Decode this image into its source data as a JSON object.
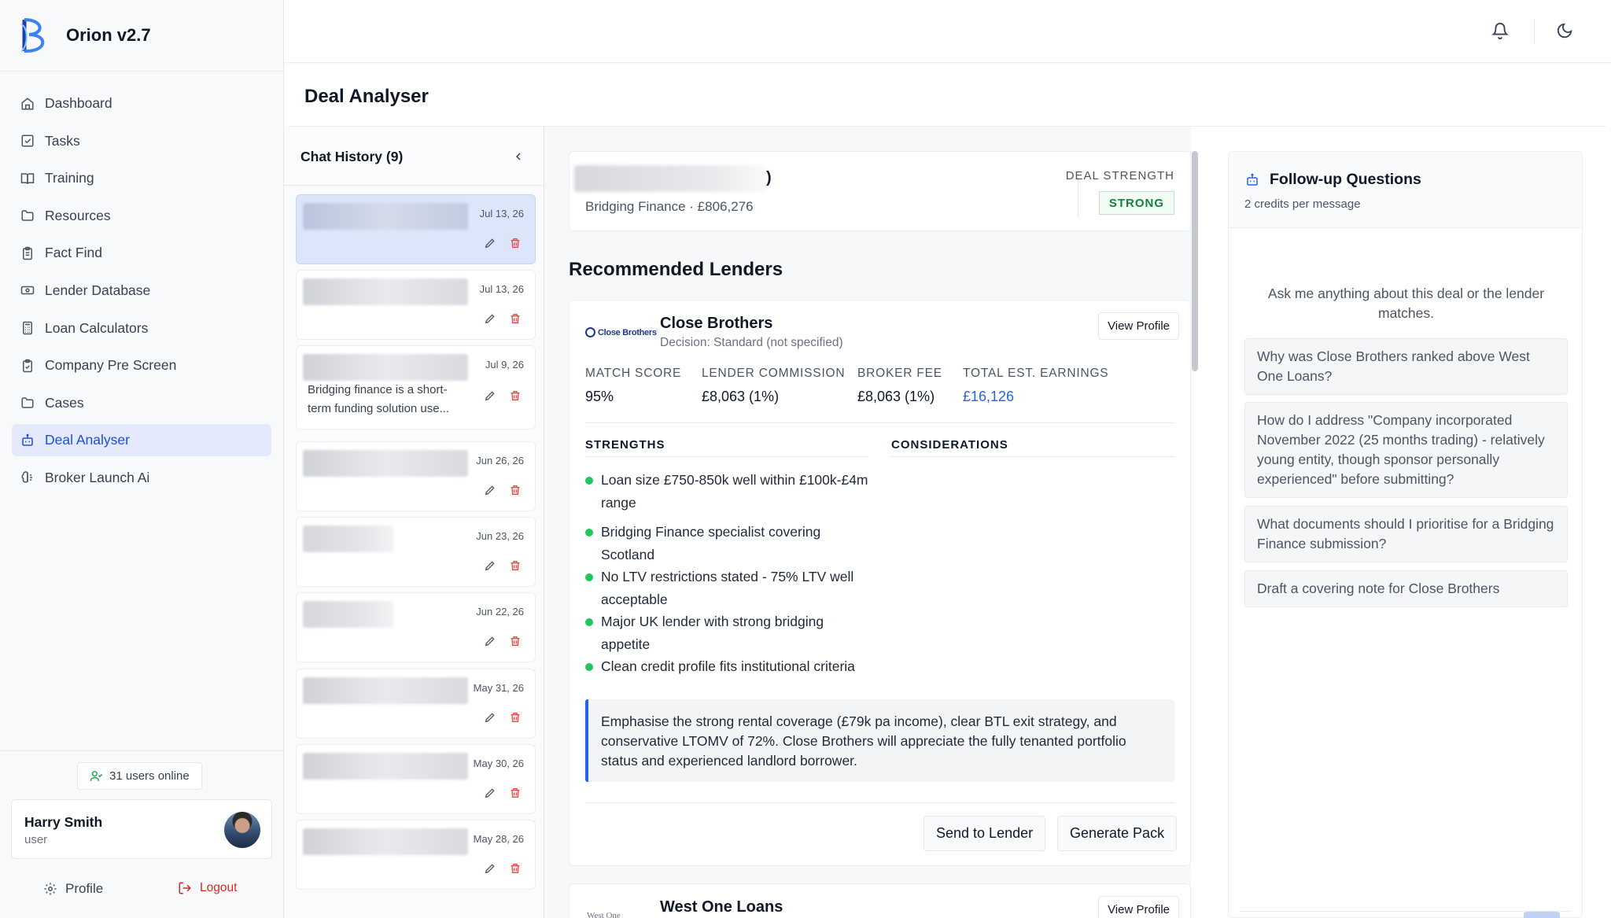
{
  "app": {
    "name": "Orion v2.7"
  },
  "sidebar": {
    "items": [
      {
        "label": "Dashboard",
        "icon": "home-icon"
      },
      {
        "label": "Tasks",
        "icon": "checkbox-icon"
      },
      {
        "label": "Training",
        "icon": "book-icon"
      },
      {
        "label": "Resources",
        "icon": "folder-icon"
      },
      {
        "label": "Fact Find",
        "icon": "clipboard-icon"
      },
      {
        "label": "Lender Database",
        "icon": "banknote-icon"
      },
      {
        "label": "Loan Calculators",
        "icon": "calculator-icon"
      },
      {
        "label": "Company Pre Screen",
        "icon": "clipboard-check-icon"
      },
      {
        "label": "Cases",
        "icon": "folder-icon"
      },
      {
        "label": "Deal Analyser",
        "icon": "bot-icon",
        "active": true
      },
      {
        "label": "Broker Launch Ai",
        "icon": "brain-icon"
      }
    ],
    "online": "31 users online",
    "user": {
      "name": "Harry Smith",
      "role": "user"
    },
    "profile_label": "Profile",
    "logout_label": "Logout"
  },
  "page": {
    "title": "Deal Analyser"
  },
  "history": {
    "title": "Chat History (9)",
    "items": [
      {
        "date": "Jul 13, 26",
        "snippet": ""
      },
      {
        "date": "Jul 13, 26",
        "snippet": ""
      },
      {
        "date": "Jul 9, 26",
        "snippet": "Bridging finance is a short-term funding solution use..."
      },
      {
        "date": "Jun 26, 26",
        "snippet": ""
      },
      {
        "date": "Jun 23, 26",
        "snippet": ""
      },
      {
        "date": "Jun 22, 26",
        "snippet": ""
      },
      {
        "date": "May 31, 26",
        "snippet": ""
      },
      {
        "date": "May 30, 26",
        "snippet": ""
      },
      {
        "date": "May 28, 26",
        "snippet": ""
      }
    ]
  },
  "deal": {
    "name_tail": ")",
    "subtitle": "Bridging Finance · £806,276",
    "strength_label": "DEAL STRENGTH",
    "strength_value": "STRONG"
  },
  "recommended": {
    "title": "Recommended Lenders",
    "lenders": [
      {
        "logo_text": "Close Brothers",
        "name": "Close Brothers",
        "decision": "Decision: Standard (not specified)",
        "view_profile": "View Profile",
        "metrics": [
          {
            "label": "MATCH SCORE",
            "value": "95%"
          },
          {
            "label": "LENDER COMMISSION",
            "value": "£8,063 (1%)"
          },
          {
            "label": "BROKER FEE",
            "value": "£8,063 (1%)"
          },
          {
            "label": "TOTAL EST. EARNINGS",
            "value": "£16,126"
          }
        ],
        "strengths_label": "STRENGTHS",
        "considerations_label": "CONSIDERATIONS",
        "strengths": [
          "Loan size £750-850k well within £100k-£4m range",
          "Bridging Finance specialist covering Scotland",
          "No LTV restrictions stated - 75% LTV well acceptable",
          "Major UK lender with strong bridging appetite",
          "Clean credit profile fits institutional criteria"
        ],
        "note": "Emphasise the strong rental coverage (£79k pa income), clear BTL exit strategy, and conservative LTOMV of 72%. Close Brothers will appreciate the fully tenanted portfolio status and experienced landlord borrower.",
        "send_label": "Send to Lender",
        "generate_label": "Generate Pack"
      },
      {
        "logo_text": "West One",
        "name": "West One Loans",
        "view_profile": "View Profile"
      }
    ]
  },
  "followup": {
    "title": "Follow-up Questions",
    "credits": "2 credits per message",
    "prompt": "Ask me anything about this deal or the lender matches.",
    "questions": [
      "Why was Close Brothers ranked above West One Loans?",
      "How do I address \"Company incorporated November 2022 (25 months trading) - relatively young entity, though sponsor personally experienced\" before submitting?",
      "What documents should I prioritise for a Bridging Finance submission?",
      "Draft a covering note for Close Brothers"
    ]
  },
  "colors": {
    "accent": "#2563eb",
    "active_bg": "#e4eafb",
    "success": "#22c55e",
    "danger": "#dc2626"
  }
}
